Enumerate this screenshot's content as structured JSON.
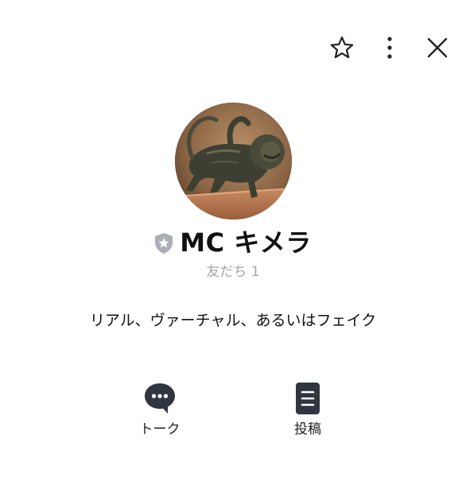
{
  "header": {
    "icons": [
      "star-outline-icon",
      "more-vertical-icon",
      "close-icon"
    ]
  },
  "profile": {
    "avatar_icon": "chimera-statue-photo",
    "badge_icon": "official-shield-icon",
    "name": "MC キメラ",
    "friends_label": "友だち 1",
    "status_message": "リアル、ヴァーチャル、あるいはフェイク"
  },
  "actions": [
    {
      "label": "トーク",
      "icon": "chat-bubble-icon"
    },
    {
      "label": "投稿",
      "icon": "post-list-icon"
    }
  ],
  "colors": {
    "icon": "#333333",
    "muted_text": "#a6a6a6",
    "badge": "#aab0b6",
    "action_icon_bg": "#2f3640"
  }
}
